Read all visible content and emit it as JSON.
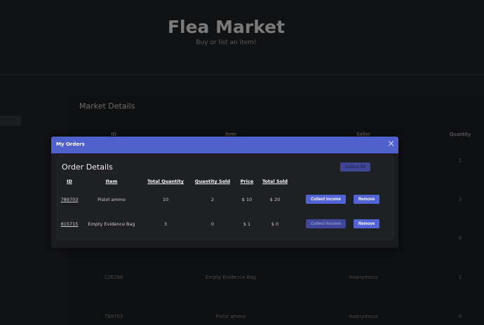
{
  "header": {
    "title": "Flea Market",
    "subtitle": "Buy or list an item!"
  },
  "market": {
    "title": "Market Details",
    "columns": [
      "ID",
      "Item",
      "Seller",
      "Quantity"
    ],
    "rows": [
      {
        "id": "",
        "item": "",
        "seller": "",
        "quantity": "1"
      },
      {
        "id": "",
        "item": "",
        "seller": "",
        "quantity": "3"
      },
      {
        "id": "",
        "item": "",
        "seller": "",
        "quantity": "8"
      },
      {
        "id": "126288",
        "item": "Empty Evidence Bag",
        "seller": "Anonymous",
        "quantity": "1"
      },
      {
        "id": "789703",
        "item": "Pistol ammo",
        "seller": "Anonymous",
        "quantity": "8"
      }
    ]
  },
  "modal": {
    "title": "My Orders",
    "close_icon": "×",
    "card_title": "Order Details",
    "collect_all": "Collect All",
    "columns": [
      "ID",
      "Item",
      "Total Quantity",
      "Quantity Sold",
      "Price",
      "Total Sold"
    ],
    "rows": [
      {
        "id": "789703",
        "item": "Pistol ammo",
        "total_quantity": "10",
        "quantity_sold": "2",
        "price": "$ 10",
        "total_sold": "$ 20",
        "collect": "Collect Income",
        "remove": "Remove"
      },
      {
        "id": "815715",
        "item": "Empty Evidence Bag",
        "total_quantity": "3",
        "quantity_sold": "0",
        "price": "$ 1",
        "total_sold": "$ 0",
        "collect": "Collect Income",
        "remove": "Remove"
      }
    ]
  },
  "colors": {
    "accent": "#5060cc",
    "button": "#5463d4",
    "background": "#111214"
  }
}
